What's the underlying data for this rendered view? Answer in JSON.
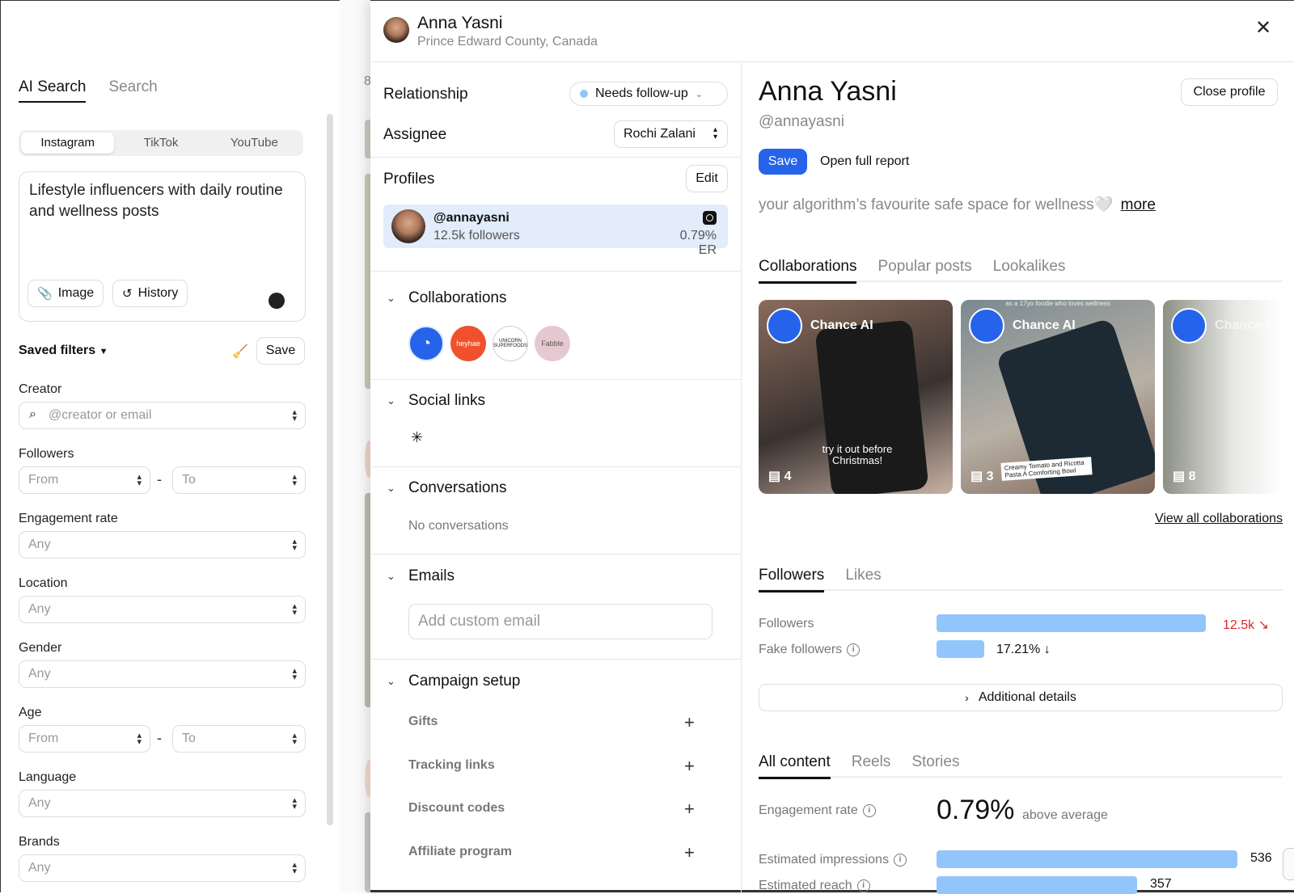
{
  "search": {
    "tabs": [
      {
        "label": "AI Search",
        "active": true
      },
      {
        "label": "Search",
        "active": false
      }
    ],
    "platforms": [
      {
        "label": "Instagram",
        "active": true
      },
      {
        "label": "TikTok",
        "active": false
      },
      {
        "label": "YouTube",
        "active": false
      }
    ],
    "query": "Lifestyle influencers with daily routine and wellness posts",
    "image_btn": "Image",
    "history_btn": "History",
    "saved_filters": "Saved filters",
    "save_btn": "Save",
    "filters": {
      "creator": {
        "label": "Creator",
        "placeholder": "@creator or email"
      },
      "followers": {
        "label": "Followers",
        "from": "From",
        "to": "To"
      },
      "engagement": {
        "label": "Engagement rate",
        "value": "Any"
      },
      "location": {
        "label": "Location",
        "value": "Any"
      },
      "gender": {
        "label": "Gender",
        "value": "Any"
      },
      "age": {
        "label": "Age",
        "from": "From",
        "to": "To"
      },
      "language": {
        "label": "Language",
        "value": "Any"
      },
      "brands": {
        "label": "Brands",
        "value": "Any"
      }
    },
    "dash": "-",
    "results_count_partial": "8"
  },
  "drawer": {
    "header": {
      "name": "Anna Yasni",
      "location": "Prince Edward County, Canada"
    },
    "relationship": {
      "label": "Relationship",
      "status": "Needs follow-up",
      "status_color": "#93c5fd"
    },
    "assignee": {
      "label": "Assignee",
      "value": "Rochi Zalani"
    },
    "profiles": {
      "title": "Profiles",
      "edit": "Edit",
      "handle": "@annayasni",
      "followers": "12.5k followers",
      "er": "0.79% ER"
    },
    "collaborations": {
      "title": "Collaborations",
      "brands": [
        "Chance AI",
        "heyhae",
        "Unicorn Superfoods",
        "Fabble"
      ],
      "logo_texts": [
        "heyhae",
        "UNICORN SUPERFOODS",
        "Fabble"
      ]
    },
    "social_links": {
      "title": "Social links"
    },
    "conversations": {
      "title": "Conversations",
      "empty": "No conversations"
    },
    "emails": {
      "title": "Emails",
      "placeholder": "Add custom email"
    },
    "campaign": {
      "title": "Campaign setup",
      "rows": [
        "Gifts",
        "Tracking links",
        "Discount codes",
        "Affiliate program"
      ]
    }
  },
  "profile": {
    "name": "Anna Yasni",
    "handle": "@annayasni",
    "close_profile": "Close profile",
    "save": "Save",
    "open_report": "Open full report",
    "bio": "your algorithm’s favourite safe space for wellness🤍",
    "more": "more",
    "tabs": [
      {
        "label": "Collaborations",
        "active": true
      },
      {
        "label": "Popular posts",
        "active": false
      },
      {
        "label": "Lookalikes",
        "active": false
      }
    ],
    "posts": [
      {
        "brand": "Chance AI",
        "comments": "4",
        "caption": "try it out before Christmas!"
      },
      {
        "brand": "Chance AI",
        "comments": "3",
        "caption": "Creamy Tomato and Ricotta Pasta A Comforting Bowl",
        "top_text": "as a 17yo foodie who loves wellness"
      },
      {
        "brand": "Chance A",
        "comments": "8"
      }
    ],
    "view_all": "View all collaborations",
    "audience_tabs": [
      {
        "label": "Followers",
        "active": true
      },
      {
        "label": "Likes",
        "active": false
      }
    ],
    "metrics": {
      "followers": {
        "label": "Followers",
        "value": "12.5k",
        "trend": "↘",
        "trend_color": "#dc2626",
        "fill": 1.0
      },
      "fake_followers": {
        "label": "Fake followers",
        "value": "17.21%",
        "trend": "↓",
        "fill": 0.1721
      }
    },
    "additional_details": "Additional details",
    "content_tabs": [
      {
        "label": "All content",
        "active": true
      },
      {
        "label": "Reels",
        "active": false
      },
      {
        "label": "Stories",
        "active": false
      }
    ],
    "engagement": {
      "label": "Engagement rate",
      "value": "0.79%",
      "note": "above average"
    },
    "impressions": {
      "label": "Estimated impressions",
      "value": "536"
    },
    "reach": {
      "label": "Estimated reach",
      "value": "357"
    }
  }
}
